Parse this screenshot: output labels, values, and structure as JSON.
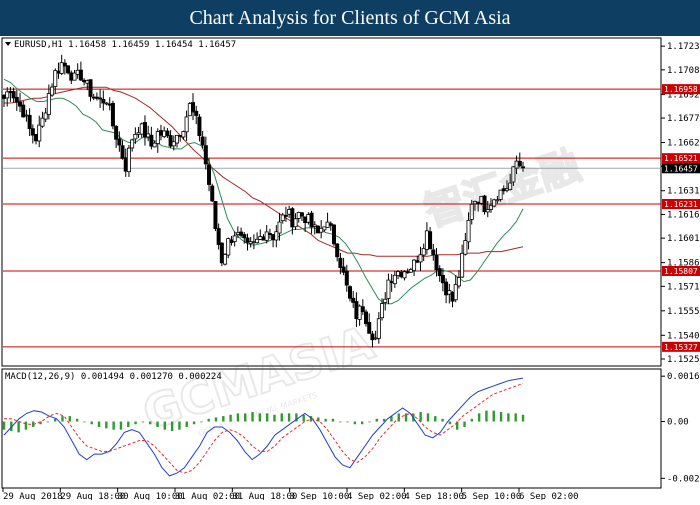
{
  "banner": {
    "title": "Chart Analysis for Clients of GCM Asia"
  },
  "watermark": {
    "text": "GCMASIA",
    "chinese": "智汇金融",
    "sub": "GCM ASIA FINANCIAL MARKETS"
  },
  "chart_data": [
    {
      "type": "candlestick",
      "symbol_header": "EURUSD,H1  1.16458 1.16459 1.16454 1.16457",
      "ylim": [
        1.1525,
        1.1725
      ],
      "price_axis_ticks": [
        "1.17230",
        "1.17080",
        "1.16925",
        "1.16775",
        "1.16620",
        "1.16470",
        "1.16315",
        "1.16165",
        "1.16015",
        "1.15860",
        "1.15710",
        "1.15555",
        "1.15400",
        "1.15250"
      ],
      "x_labels": [
        "29 Aug 2018",
        "29 Aug 18:00",
        "30 Aug 10:00",
        "31 Aug 02:00",
        "31 Aug 18:00",
        "3 Sep 10:00",
        "4 Sep 02:00",
        "4 Sep 18:00",
        "5 Sep 10:00",
        "6 Sep 02:00"
      ],
      "horizontal_lines": [
        {
          "value": 1.16958,
          "label": "1.16958",
          "color": "#cc0000"
        },
        {
          "value": 1.16521,
          "label": "1.16521",
          "color": "#cc0000"
        },
        {
          "value": 1.16231,
          "label": "1.16231",
          "color": "#cc0000"
        },
        {
          "value": 1.15807,
          "label": "1.15807",
          "color": "#cc0000"
        },
        {
          "value": 1.15327,
          "label": "1.15327",
          "color": "#cc0000"
        }
      ],
      "current_price": {
        "value": 1.16457,
        "label": "1.16457"
      },
      "close_path": [
        1.169,
        1.1697,
        1.1688,
        1.1682,
        1.167,
        1.1665,
        1.1676,
        1.1693,
        1.1706,
        1.1712,
        1.1709,
        1.1702,
        1.1705,
        1.1697,
        1.1691,
        1.1688,
        1.169,
        1.1673,
        1.166,
        1.1647,
        1.1665,
        1.1672,
        1.1668,
        1.166,
        1.1668,
        1.1667,
        1.1663,
        1.1667,
        1.1673,
        1.1685,
        1.1675,
        1.1661,
        1.1636,
        1.1608,
        1.1588,
        1.1599,
        1.1605,
        1.16,
        1.1595,
        1.1597,
        1.1602,
        1.1607,
        1.1603,
        1.161,
        1.1618,
        1.1613,
        1.1617,
        1.1615,
        1.1609,
        1.1604,
        1.1612,
        1.1606,
        1.1594,
        1.1578,
        1.1562,
        1.1553,
        1.1558,
        1.1545,
        1.1538,
        1.1557,
        1.1575,
        1.158,
        1.1581,
        1.1582,
        1.1585,
        1.1594,
        1.1605,
        1.1592,
        1.1578,
        1.157,
        1.1562,
        1.1578,
        1.1598,
        1.1625,
        1.1627,
        1.1622,
        1.1625,
        1.163,
        1.1632,
        1.1636,
        1.165,
        1.1646
      ],
      "ma_fast_path": [
        1.1702,
        1.17,
        1.1696,
        1.1693,
        1.169,
        1.1688,
        1.1688,
        1.1689,
        1.169,
        1.169,
        1.1688,
        1.1685,
        1.168,
        1.1678,
        1.1675,
        1.167,
        1.1669,
        1.1668,
        1.1664,
        1.1662,
        1.1662,
        1.1665,
        1.1665,
        1.1663,
        1.166,
        1.1659,
        1.1658,
        1.1658,
        1.1661,
        1.1662,
        1.166,
        1.1652,
        1.1642,
        1.1628,
        1.1614,
        1.1606,
        1.1601,
        1.1598,
        1.1597,
        1.1598,
        1.1599,
        1.1601,
        1.1603,
        1.1605,
        1.1607,
        1.1607,
        1.1608,
        1.1608,
        1.1607,
        1.1605,
        1.1604,
        1.1602,
        1.1598,
        1.1592,
        1.1585,
        1.1577,
        1.157,
        1.1563,
        1.156,
        1.156,
        1.1562,
        1.1566,
        1.157,
        1.1573,
        1.1576,
        1.1578,
        1.1581,
        1.1581,
        1.158,
        1.1577,
        1.1574,
        1.1575,
        1.158,
        1.1586,
        1.1592,
        1.1598,
        1.1603,
        1.1607,
        1.1612,
        1.162
      ],
      "ma_slow_path": [
        1.1687,
        1.1687,
        1.1688,
        1.1689,
        1.169,
        1.169,
        1.1691,
        1.1693,
        1.1694,
        1.1695,
        1.1696,
        1.1697,
        1.1697,
        1.1697,
        1.1697,
        1.1695,
        1.1694,
        1.1692,
        1.169,
        1.1687,
        1.1684,
        1.168,
        1.1676,
        1.1672,
        1.1667,
        1.1662,
        1.1657,
        1.1653,
        1.1648,
        1.1644,
        1.164,
        1.1637,
        1.1634,
        1.1631,
        1.1627,
        1.1625,
        1.1622,
        1.1619,
        1.1616,
        1.1613,
        1.161,
        1.1607,
        1.1604,
        1.16,
        1.1598,
        1.1596,
        1.1594,
        1.1592,
        1.1592,
        1.1591,
        1.1591,
        1.159,
        1.159,
        1.159,
        1.159,
        1.159,
        1.159,
        1.159,
        1.159,
        1.1591,
        1.1591,
        1.1591,
        1.1591,
        1.1592,
        1.1592,
        1.1592,
        1.1593,
        1.1593,
        1.1593,
        1.1594,
        1.1595,
        1.1596
      ],
      "colors": {
        "bull": "#ffffff",
        "bear": "#000000",
        "ma_fast": "#2e8b57",
        "ma_slow": "#a52a2a",
        "support_resistance": "#cc0000"
      }
    },
    {
      "type": "macd",
      "header": "MACD(12,26,9) 0.001494 0.001270 0.000224",
      "ylim": [
        -0.0023,
        0.00175
      ],
      "axis_ticks": [
        {
          "value": 0.00167,
          "label": "0.00167"
        },
        {
          "value": 0.0,
          "label": "0.00"
        },
        {
          "value": -0.00209,
          "label": "-0.00209"
        }
      ],
      "histogram": [
        -0.0003,
        -0.00035,
        -0.0004,
        -0.0003,
        -0.0002,
        -0.0001,
        0.0,
        0.0001,
        0.0002,
        0.0002,
        0.0001,
        0.0,
        -0.0001,
        -0.0002,
        -0.00025,
        -0.0003,
        -0.0003,
        -0.0002,
        -0.0001,
        0.0,
        -0.0001,
        -0.0002,
        -0.0003,
        -0.00035,
        -0.0003,
        -0.0002,
        -0.0001,
        0.0,
        0.0001,
        0.00015,
        0.0002,
        0.00025,
        0.0003,
        0.0003,
        0.00035,
        0.0003,
        0.0003,
        0.00025,
        0.0003,
        0.0003,
        0.0003,
        0.00025,
        0.0002,
        0.00015,
        0.0001,
        0.0001,
        0.0,
        0.0,
        -0.0001,
        -0.0001,
        0.0,
        0.0001,
        0.0001,
        0.0002,
        0.0003,
        0.0003,
        0.0003,
        0.00035,
        0.0003,
        0.0002,
        0.0001,
        -0.0001,
        -0.0003,
        -0.0002,
        0.0001,
        0.0003,
        0.0004,
        0.0004,
        0.00035,
        0.0003,
        0.0003,
        0.00025
      ],
      "macd_line": [
        -0.0005,
        -0.0002,
        0.0001,
        0.0003,
        0.0004,
        0.00035,
        0.0002,
        0.0001,
        -0.0002,
        -0.0007,
        -0.0012,
        -0.0014,
        -0.0012,
        -0.0012,
        -0.0011,
        -0.0008,
        -0.0004,
        -0.0003,
        -0.0004,
        -0.0008,
        -0.0012,
        -0.0017,
        -0.002,
        -0.0019,
        -0.0017,
        -0.0013,
        -0.0009,
        -0.0004,
        -0.0002,
        -0.0002,
        -0.0004,
        -0.0007,
        -0.0011,
        -0.0014,
        -0.0012,
        -0.0009,
        -0.0005,
        -0.0003,
        -0.0001,
        0.0001,
        0.0003,
        0.0001,
        -0.0003,
        -0.0008,
        -0.0013,
        -0.0016,
        -0.0017,
        -0.0013,
        -0.0009,
        -0.0005,
        -0.0002,
        0.0001,
        0.0003,
        0.0005,
        0.0003,
        -0.0001,
        -0.0005,
        -0.0006,
        -0.0004,
        0.0,
        0.0003,
        0.0006,
        0.0009,
        0.0011,
        0.0012,
        0.0013,
        0.0014,
        0.0015,
        0.00155,
        0.0016
      ],
      "signal_line": [
        0.0001,
        0.0001,
        0.0,
        -0.0001,
        -0.0001,
        0.0,
        0.0002,
        0.0003,
        0.0002,
        -0.0002,
        -0.0006,
        -0.0009,
        -0.001,
        -0.0011,
        -0.0011,
        -0.001,
        -0.0009,
        -0.0008,
        -0.0007,
        -0.0007,
        -0.0009,
        -0.0012,
        -0.0015,
        -0.0018,
        -0.0019,
        -0.0018,
        -0.0015,
        -0.0011,
        -0.0007,
        -0.0004,
        -0.0003,
        -0.0004,
        -0.0006,
        -0.0009,
        -0.0011,
        -0.0011,
        -0.0009,
        -0.0006,
        -0.0004,
        -0.0002,
        0.0,
        0.0001,
        0.0,
        -0.0003,
        -0.0007,
        -0.0011,
        -0.0014,
        -0.0015,
        -0.0013,
        -0.001,
        -0.0006,
        -0.0003,
        0.0,
        0.0002,
        0.0003,
        0.0001,
        -0.0002,
        -0.0004,
        -0.0005,
        -0.0003,
        -0.0001,
        0.0002,
        0.0004,
        0.0006,
        0.0008,
        0.001,
        0.0011,
        0.0012,
        0.0013,
        0.0014
      ],
      "colors": {
        "histogram": "#2e9b2e",
        "macd": "#1f3fcf",
        "signal": "#e03030"
      }
    }
  ]
}
